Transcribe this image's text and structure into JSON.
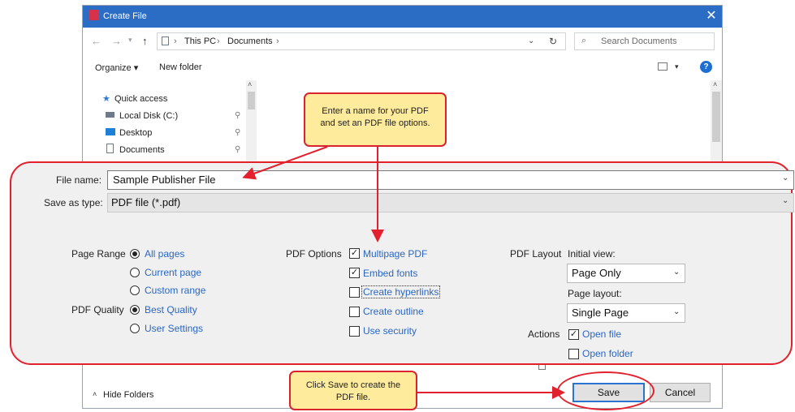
{
  "window": {
    "title": "Create File"
  },
  "address": {
    "crumbs": [
      "This PC",
      "Documents"
    ]
  },
  "search": {
    "placeholder": "Search Documents"
  },
  "toolbar": {
    "organize": "Organize ▾",
    "new_folder": "New folder"
  },
  "sidebar": {
    "items": [
      "Quick access",
      "Local Disk (C:)",
      "Desktop",
      "Documents"
    ]
  },
  "form": {
    "file_name_label": "File name:",
    "file_name_value": "Sample Publisher File",
    "save_type_label": "Save as type:",
    "save_type_value": "PDF file (*.pdf)"
  },
  "page_range": {
    "label": "Page Range",
    "options": [
      "All pages",
      "Current page",
      "Custom range"
    ],
    "selected": "All pages"
  },
  "pdf_quality": {
    "label": "PDF Quality",
    "options": [
      "Best Quality",
      "User Settings"
    ],
    "selected": "Best Quality"
  },
  "pdf_options": {
    "label": "PDF Options",
    "items": [
      {
        "label": "Multipage PDF",
        "checked": true
      },
      {
        "label": "Embed fonts",
        "checked": true
      },
      {
        "label": "Create hyperlinks",
        "checked": false
      },
      {
        "label": "Create outline",
        "checked": false
      },
      {
        "label": "Use security",
        "checked": false
      }
    ]
  },
  "pdf_layout": {
    "label": "PDF Layout",
    "initial_view_label": "Initial view:",
    "initial_view_value": "Page Only",
    "page_layout_label": "Page layout:",
    "page_layout_value": "Single Page"
  },
  "actions": {
    "label": "Actions",
    "items": [
      {
        "label": "Open file",
        "checked": true
      },
      {
        "label": "Open folder",
        "checked": false
      }
    ]
  },
  "footer": {
    "hide_folders": "Hide Folders",
    "save": "Save",
    "cancel": "Cancel"
  },
  "callouts": {
    "top": "Enter a name for your PDF and set an PDF file options.",
    "bottom": "Click Save to create the PDF file."
  },
  "colors": {
    "accent": "#2b6cc4",
    "annotation": "#e3202e",
    "callout_fill": "#ffeb9c",
    "link_text": "#2a66c2"
  }
}
